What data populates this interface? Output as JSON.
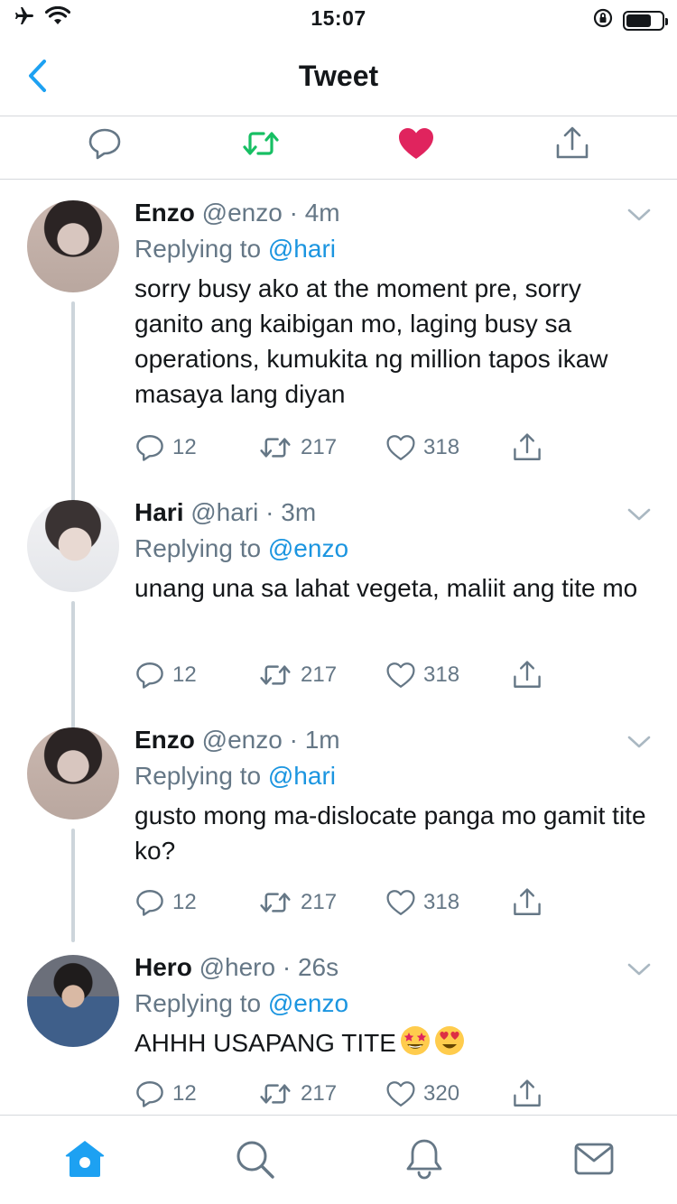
{
  "status_bar": {
    "time": "15:07"
  },
  "nav": {
    "title": "Tweet"
  },
  "reply_prefix": "Replying to ",
  "tweets": [
    {
      "name": "Enzo",
      "handle": "@enzo",
      "time": "4m",
      "reply_to": "@hari",
      "text": "sorry busy ako at the moment pre, sorry ganito ang kaibigan mo, laging busy sa operations, kumukita ng million tapos ikaw masaya lang diyan",
      "replies": "12",
      "retweets": "217",
      "likes": "318"
    },
    {
      "name": "Hari",
      "handle": "@hari",
      "time": "3m",
      "reply_to": "@enzo",
      "text": "unang una sa lahat vegeta, maliit ang tite mo",
      "replies": "12",
      "retweets": "217",
      "likes": "318"
    },
    {
      "name": "Enzo",
      "handle": "@enzo",
      "time": "1m",
      "reply_to": "@hari",
      "text": "gusto mong ma-dislocate panga mo gamit tite ko?",
      "replies": "12",
      "retweets": "217",
      "likes": "318"
    },
    {
      "name": "Hero",
      "handle": "@hero",
      "time": "26s",
      "reply_to": "@enzo",
      "text": "AHHH USAPANG TITE",
      "emojis": [
        "star-struck-emoji",
        "heart-eyes-emoji"
      ],
      "replies": "12",
      "retweets": "217",
      "likes": "320"
    }
  ],
  "colors": {
    "accent": "#1da1f2",
    "link": "#1b95e0",
    "retweet_green": "#17bf63",
    "like_red": "#e0245e",
    "muted": "#657786",
    "divider": "#d5d8dc"
  },
  "icons": {
    "status_left": [
      "airplane-icon",
      "wifi-icon"
    ],
    "status_right": [
      "orientation-lock-icon",
      "battery-icon"
    ],
    "main_actions": [
      "reply-icon",
      "retweet-icon",
      "like-icon",
      "share-icon"
    ],
    "tabs": [
      "home-icon",
      "search-icon",
      "notifications-icon",
      "messages-icon"
    ]
  },
  "tabs": {
    "active": "home"
  }
}
